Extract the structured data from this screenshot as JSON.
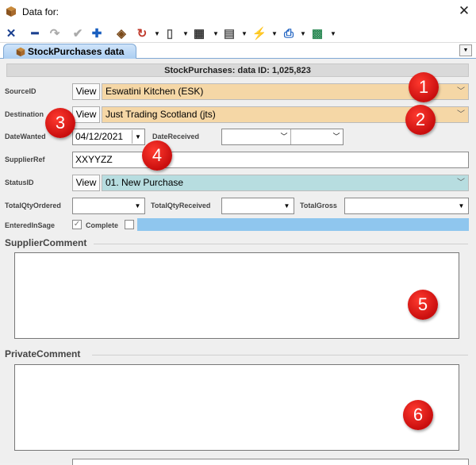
{
  "window": {
    "title": "Data for:",
    "close_glyph": "✕"
  },
  "toolbar": [
    {
      "name": "delete-icon",
      "glyph": "✕",
      "color": "#1a3f8f"
    },
    {
      "name": "remove-icon",
      "glyph": "━",
      "color": "#1a3f8f"
    },
    {
      "name": "redo-icon",
      "glyph": "↷",
      "color": "#aaaaaa"
    },
    {
      "name": "accept-icon",
      "glyph": "✔",
      "color": "#aaaaaa"
    },
    {
      "name": "add-icon",
      "glyph": "✚",
      "color": "#1a5fc0"
    },
    {
      "name": "eraser-icon",
      "glyph": "◈",
      "color": "#7a4a1a"
    },
    {
      "name": "refresh-icon",
      "glyph": "↻",
      "color": "#c0392b"
    },
    {
      "name": "document-icon",
      "glyph": "▯",
      "color": "#555555"
    },
    {
      "name": "grid-icon",
      "glyph": "▦",
      "color": "#333333"
    },
    {
      "name": "form-icon",
      "glyph": "▤",
      "color": "#555555"
    },
    {
      "name": "lightning-icon",
      "glyph": "⚡",
      "color": "#e6b800"
    },
    {
      "name": "print-icon",
      "glyph": "⎙",
      "color": "#1a5fc0"
    },
    {
      "name": "export-icon",
      "glyph": "▩",
      "color": "#2e8b57"
    }
  ],
  "tab": {
    "label": "StockPurchases data"
  },
  "header": {
    "text": "StockPurchases: data ID: 1,025,823"
  },
  "labels": {
    "source": "SourceID",
    "destination": "Destination",
    "date_wanted": "DateWanted",
    "date_received": "DateReceived",
    "supplier_ref": "SupplierRef",
    "status": "StatusID",
    "total_qty_ordered": "TotalQtyOrdered",
    "total_qty_received": "TotalQtyReceived",
    "total_gross": "TotalGross",
    "entered_in_sage": "EnteredInSage",
    "complete": "Complete"
  },
  "buttons": {
    "view": "View"
  },
  "values": {
    "source": "Eswatini Kitchen (ESK)",
    "destination": "Just Trading Scotland (jts)",
    "date_wanted": "04/12/2021",
    "date_received": "",
    "supplier_ref": "XXYYZZ",
    "status": "01. New Purchase",
    "total_qty_ordered": "",
    "total_qty_received": "",
    "total_gross": "",
    "entered_in_sage": true,
    "complete": false
  },
  "sections": {
    "supplier_comment": "SupplierComment",
    "private_comment": "PrivateComment"
  },
  "callouts": [
    "1",
    "2",
    "3",
    "4",
    "5",
    "6"
  ],
  "colors": {
    "source_bg": "#f5d7a6",
    "status_bg": "#b7dde0",
    "badge": "#d81b1b",
    "bluebar": "#8fc6ee"
  }
}
